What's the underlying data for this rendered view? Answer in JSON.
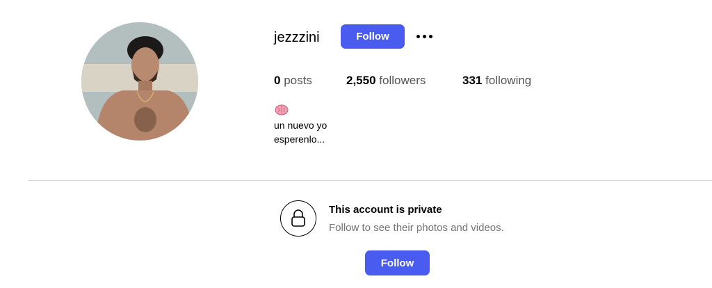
{
  "profile": {
    "username": "jezzzini",
    "follow_label": "Follow",
    "more_icon": "more-horizontal-icon",
    "avatar_alt": "profile photo"
  },
  "stats": {
    "posts_count": "0",
    "posts_label": "posts",
    "followers_count": "2,550",
    "followers_label": "followers",
    "following_count": "331",
    "following_label": "following"
  },
  "bio": {
    "emoji_icon": "brain-emoji",
    "line1": "un nuevo yo",
    "line2": "esperenlo..."
  },
  "private_notice": {
    "title": "This account is private",
    "subtitle": "Follow to see their photos and videos.",
    "follow_label": "Follow",
    "lock_icon": "lock-icon"
  },
  "colors": {
    "accent": "#4a5cf0",
    "muted_text": "#737373",
    "divider": "#dbdbdb"
  }
}
